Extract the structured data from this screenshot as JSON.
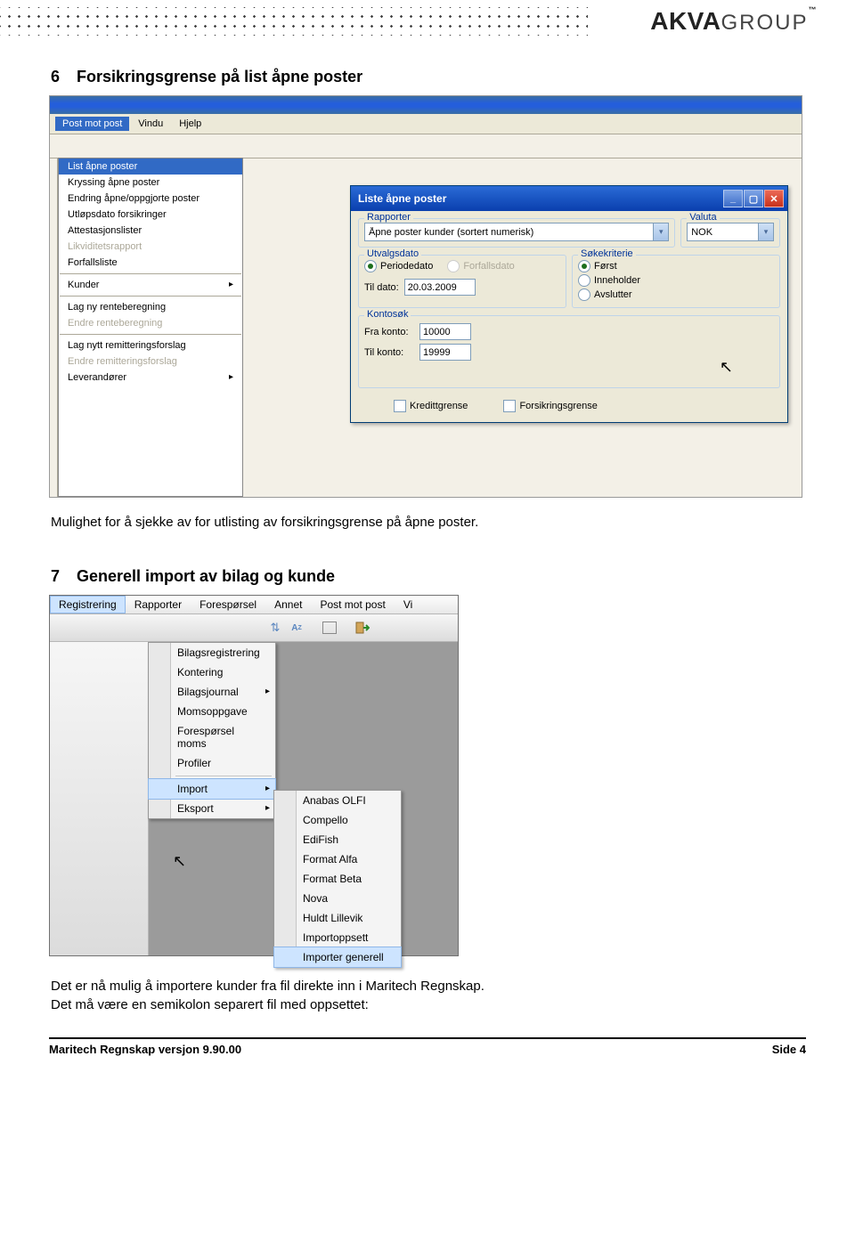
{
  "header": {
    "brand_bold": "AKVA",
    "brand_thin": "GROUP",
    "tm": "™"
  },
  "sec6": {
    "num": "6",
    "title": "Forsikringsgrense på list åpne poster",
    "body": "Mulighet for å sjekke av for utlisting av forsikringsgrense på åpne poster."
  },
  "sec7": {
    "num": "7",
    "title": "Generell import  av bilag og kunde",
    "body1": "Det er nå mulig å importere kunder fra fil direkte inn i Maritech Regnskap.",
    "body2": "Det må være en semikolon separert fil med oppsettet:"
  },
  "footer": {
    "left": "Maritech Regnskap versjon 9.90.00",
    "right": "Side 4"
  },
  "shot1": {
    "menubar": {
      "m1": "Post mot post",
      "m2": "Vindu",
      "m3": "Hjelp"
    },
    "menu": {
      "i0": "List åpne poster",
      "i1": "Kryssing åpne poster",
      "i2": "Endring åpne/oppgjorte poster",
      "i3": "Utløpsdato forsikringer",
      "i4": "Attestasjonslister",
      "i5": "Likviditetsrapport",
      "i6": "Forfallsliste",
      "i7": "Kunder",
      "i8": "Lag ny renteberegning",
      "i9": "Endre renteberegning",
      "i10": "Lag nytt remitteringsforslag",
      "i11": "Endre remitteringsforslag",
      "i12": "Leverandører"
    },
    "dlg": {
      "title": "Liste åpne poster",
      "grp_rapporter": "Rapporter",
      "rapporter_val": "Åpne poster kunder (sortert numerisk)",
      "grp_valuta": "Valuta",
      "valuta_val": "NOK",
      "grp_utvalg": "Utvalgsdato",
      "r_periode": "Periodedato",
      "r_forfall": "Forfallsdato",
      "lbl_tildato": "Til dato:",
      "tildato_val": "20.03.2009",
      "grp_sok": "Søkekriterie",
      "r_forst": "Først",
      "r_inneholder": "Inneholder",
      "r_avslutter": "Avslutter",
      "grp_konto": "Kontosøk",
      "lbl_frakonto": "Fra konto:",
      "frakonto_val": "10000",
      "lbl_tilkonto": "Til konto:",
      "tilkonto_val": "19999",
      "chk_kreditt": "Kredittgrense",
      "chk_forsikring": "Forsikringsgrense"
    }
  },
  "shot2": {
    "menubar": {
      "m1": "Registrering",
      "m2": "Rapporter",
      "m3": "Forespørsel",
      "m4": "Annet",
      "m5": "Post mot post",
      "m6": "Vi"
    },
    "menu": {
      "i0": "Bilagsregistrering",
      "i1": "Kontering",
      "i2": "Bilagsjournal",
      "i3": "Momsoppgave",
      "i4": "Forespørsel moms",
      "i5": "Profiler",
      "i6": "Import",
      "i7": "Eksport"
    },
    "submenu": {
      "s0": "Anabas OLFI",
      "s1": "Compello",
      "s2": "EdiFish",
      "s3": "Format Alfa",
      "s4": "Format Beta",
      "s5": "Nova",
      "s6": "Huldt Lillevik",
      "s7": "Importoppsett",
      "s8": "Importer generell"
    }
  }
}
